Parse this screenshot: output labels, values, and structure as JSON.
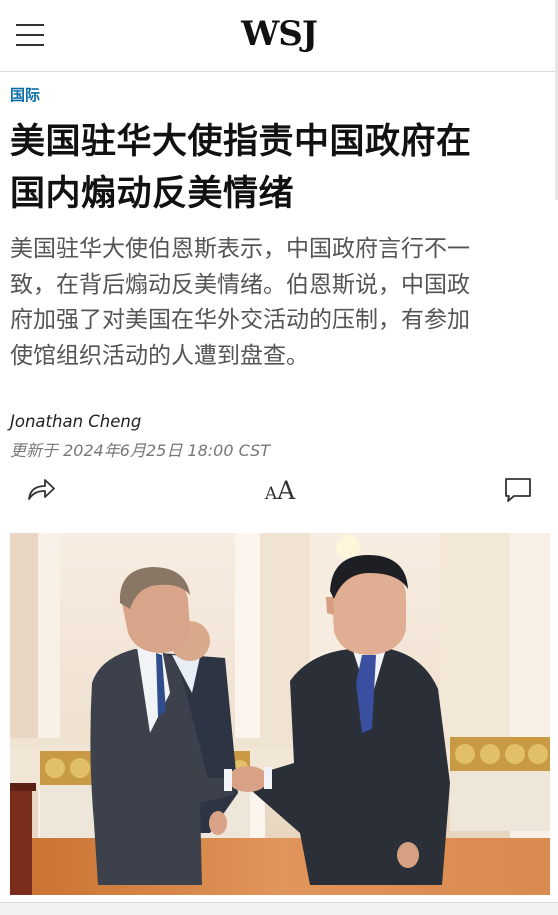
{
  "header": {
    "logo": "WSJ"
  },
  "article": {
    "section": "国际",
    "headline_line1": "美国驻华大使指责中国政府在",
    "headline_line2": "国内煽动反美情绪",
    "summary_line1": "美国驻华大使伯恩斯表示，中国政府言行不一",
    "summary_line2": "致，在背后煽动反美情绪。伯恩斯说，中国政",
    "summary_line3": "府加强了对美国在华外交活动的压制，有参加",
    "summary_line4": "使馆组织活动的人遭到盘查。",
    "author": "Jonathan Cheng",
    "updated": "更新于 2024年6月25日 18:00 CST"
  },
  "toolbar": {
    "share_icon": "share-icon",
    "text_size_icon": "text-size-icon",
    "comment_icon": "comment-icon"
  },
  "colors": {
    "section": "#0a6ea8",
    "headline": "#111111",
    "summary": "#555555"
  }
}
